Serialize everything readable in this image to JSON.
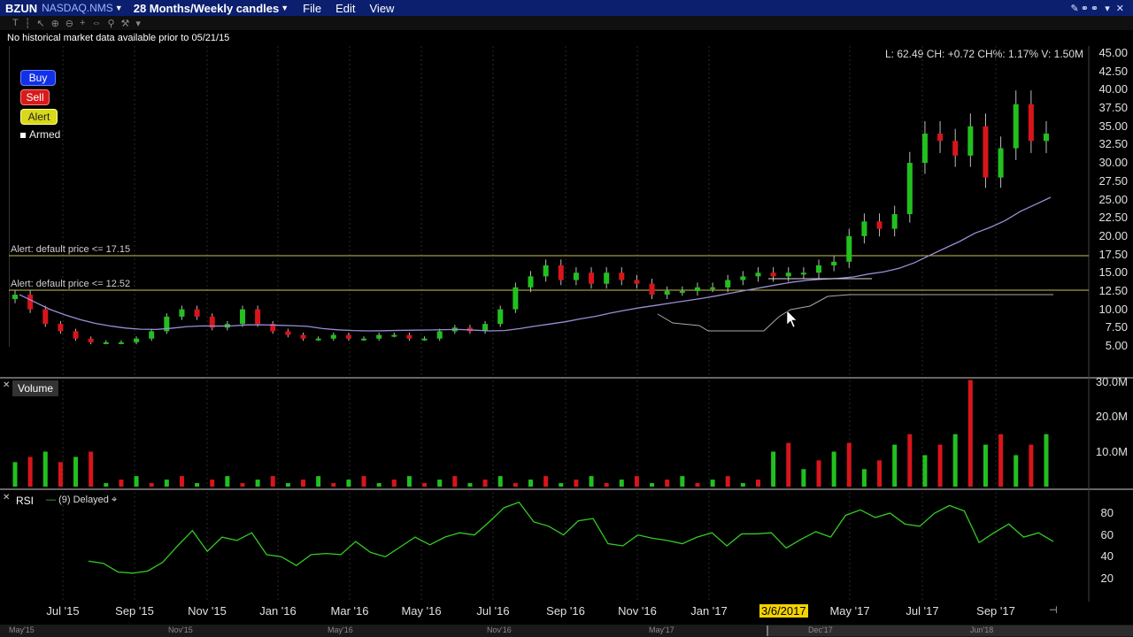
{
  "titlebar": {
    "symbol": "BZUN",
    "exchange": "NASDAQ.NMS",
    "period": "28 Months/Weekly candles",
    "menu": [
      "File",
      "Edit",
      "View"
    ]
  },
  "notice": "No historical market data available prior to 05/21/15",
  "quote": "L: 62.49 CH: +0.72 CH%: 1.17% V: 1.50M",
  "buttons": {
    "buy": "Buy",
    "sell": "Sell",
    "alert": "Alert",
    "armed": "Armed"
  },
  "alerts": [
    {
      "label": "Alert: default price <= 17.15"
    },
    {
      "label": "Alert: default price <= 12.52"
    }
  ],
  "price_axis": [
    "45.00",
    "42.50",
    "40.00",
    "37.50",
    "35.00",
    "32.50",
    "30.00",
    "27.50",
    "25.00",
    "22.50",
    "20.00",
    "17.50",
    "15.00",
    "12.50",
    "10.00",
    "7.50",
    "5.00"
  ],
  "volume": {
    "label": "Volume",
    "axis": [
      "30.0M",
      "20.0M",
      "10.0M"
    ]
  },
  "rsi": {
    "label": "RSI",
    "params": "(9) Delayed",
    "axis": [
      "80",
      "60",
      "40",
      "20"
    ]
  },
  "date_axis": [
    "Jul '15",
    "Sep '15",
    "Nov '15",
    "Jan '16",
    "Mar '16",
    "May '16",
    "Jul '16",
    "Sep '16",
    "Nov '16",
    "Jan '17",
    "May '17",
    "Jul '17",
    "Sep '17"
  ],
  "crosshair_date": "3/6/2017",
  "scrollbar_labels": [
    "May'15",
    "Nov'15",
    "May'16",
    "Nov'16",
    "May'17",
    "Dec'17",
    "Jun'18"
  ],
  "colors": {
    "up": "#22c01f",
    "down": "#d8151a",
    "ma": "#9a8ed8",
    "alert_line": "#c9c24a",
    "rsi": "#33cc22"
  },
  "chart_data": [
    {
      "type": "candlestick",
      "title": "BZUN",
      "ylim": [
        5,
        45
      ],
      "close_approx": [
        12,
        10,
        8,
        7,
        6,
        5.5,
        5.5,
        5.5,
        6,
        7,
        9,
        10,
        9,
        7.5,
        8,
        10,
        8,
        7,
        6.5,
        6,
        6,
        6.5,
        6,
        6,
        6.5,
        6.5,
        6,
        6,
        7,
        7.5,
        7,
        8,
        10,
        13,
        14.5,
        16,
        14,
        15,
        13.5,
        15,
        14,
        13.5,
        12,
        12.5,
        12.5,
        13,
        13,
        14,
        14.5,
        15,
        14.5,
        15,
        15,
        16,
        16.5,
        20,
        22,
        21,
        23,
        30,
        34,
        33,
        31,
        35,
        28,
        32,
        38,
        33,
        34
      ],
      "ma": {
        "start": 11,
        "end": 24.5
      }
    },
    {
      "type": "bar",
      "title": "Volume",
      "ylim": [
        0,
        35
      ],
      "unit": "M",
      "peak": 30.5
    },
    {
      "type": "line",
      "title": "RSI",
      "ylim": [
        10,
        95
      ],
      "values": [
        36,
        34,
        26,
        25,
        27,
        35,
        50,
        64,
        45,
        58,
        55,
        62,
        42,
        40,
        32,
        42,
        43,
        42,
        54,
        44,
        40,
        49,
        58,
        51,
        58,
        62,
        60,
        72,
        85,
        90,
        72,
        68,
        60,
        73,
        75,
        52,
        50,
        60,
        57,
        55,
        52,
        58,
        62,
        50,
        61,
        61,
        62,
        48,
        56,
        63,
        58,
        78,
        83,
        76,
        80,
        70,
        68,
        80,
        87,
        82,
        53,
        62,
        70,
        58,
        62,
        54
      ]
    }
  ]
}
